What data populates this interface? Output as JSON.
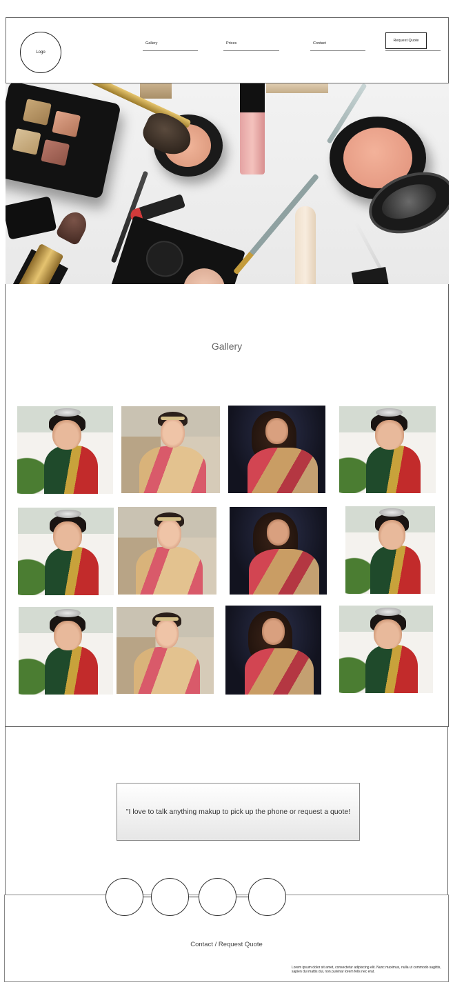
{
  "header": {
    "logo_label": "Logo",
    "nav": [
      {
        "label": "Gallery"
      },
      {
        "label": "Prices"
      },
      {
        "label": "Contact"
      }
    ],
    "request_quote_label": "Request Quote"
  },
  "hero": {
    "image": "makeup-flatlay-image"
  },
  "gallery": {
    "title": "Gallery",
    "photos": [
      {
        "kind": "bride-outdoor-green-saree"
      },
      {
        "kind": "bride-palace-rose-saree"
      },
      {
        "kind": "bride-dark-studio-red-saree"
      },
      {
        "kind": "bride-outdoor-green-saree"
      },
      {
        "kind": "bride-outdoor-green-saree"
      },
      {
        "kind": "bride-palace-rose-saree"
      },
      {
        "kind": "bride-dark-studio-red-saree"
      },
      {
        "kind": "bride-outdoor-green-saree"
      },
      {
        "kind": "bride-outdoor-green-saree"
      },
      {
        "kind": "bride-palace-rose-saree"
      },
      {
        "kind": "bride-dark-studio-red-saree"
      },
      {
        "kind": "bride-outdoor-green-saree"
      }
    ]
  },
  "quote": {
    "text": "\"I love to talk anything makup to pick up the phone or request a quote!"
  },
  "social": {
    "icons": [
      "social-icon-1",
      "social-icon-2",
      "social-icon-3",
      "social-icon-4"
    ]
  },
  "footer": {
    "contact_label": "Contact / Request Quote",
    "lorem": "Lorem ipsum dolor sit amet, consectetur adipiscing elit. Nunc maximus, nulla ut commodo sagittis, sapien dui mattis dui, non pulvinar lorem felis nec erat."
  }
}
